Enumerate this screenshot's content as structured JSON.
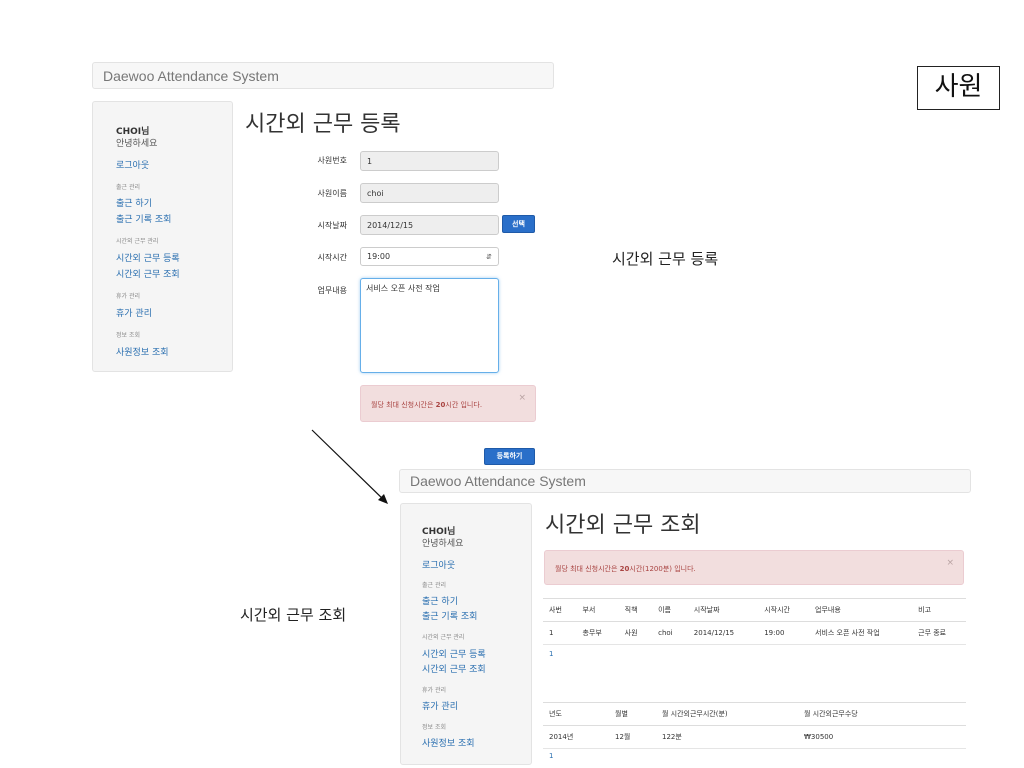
{
  "app_name": "Daewoo Attendance System",
  "badge": "사원",
  "sidebar": {
    "user": "CHOI님",
    "greeting": "안녕하세요",
    "logout": "로그아웃",
    "sections": [
      {
        "title": "출근 관리",
        "items": [
          "출근 하기",
          "출근 기록 조회"
        ]
      },
      {
        "title": "시간외 근무 관리",
        "items": [
          "시간외 근무 등록",
          "시간외 근무 조회"
        ]
      },
      {
        "title": "휴가 관리",
        "items": [
          "휴가 관리"
        ]
      },
      {
        "title": "정보 조회",
        "items": [
          "사원정보 조회"
        ]
      }
    ]
  },
  "register": {
    "title": "시간외 근무 등록",
    "caption": "시간외 근무 등록",
    "fields": {
      "emp_no_label": "사원번호",
      "emp_no_value": "1",
      "emp_name_label": "사원이름",
      "emp_name_value": "choi",
      "start_date_label": "시작날짜",
      "start_date_value": "2014/12/15",
      "select_button": "선택",
      "start_time_label": "시작시간",
      "start_time_value": "19:00",
      "work_label": "업무내용",
      "work_value": "서비스 오픈 사전 작업"
    },
    "alert": {
      "prefix": "월당 최대 신청시간은 ",
      "strong": "20",
      "suffix": "시간 입니다.",
      "close": "×"
    },
    "submit_button": "등록하기"
  },
  "lookup": {
    "title": "시간외 근무 조회",
    "caption": "시간외 근무 조회",
    "alert": {
      "prefix": "월당 최대 신청시간은 ",
      "strong": "20",
      "suffix": "시간(1200분) 입니다.",
      "close": "×"
    },
    "table1": {
      "headers": [
        "사번",
        "부서",
        "직책",
        "이름",
        "시작날짜",
        "시작시간",
        "업무내용",
        "비고"
      ],
      "rows": [
        [
          "1",
          "총무부",
          "사원",
          "choi",
          "2014/12/15",
          "19:00",
          "서비스 오픈 사전 작업",
          "근무 종료"
        ]
      ],
      "page": "1"
    },
    "table2": {
      "headers": [
        "년도",
        "월별",
        "월 시간외근무시간(분)",
        "월 시간외근무수당"
      ],
      "rows": [
        [
          "2014년",
          "12월",
          "122분",
          "₩30500"
        ]
      ],
      "page": "1"
    }
  }
}
